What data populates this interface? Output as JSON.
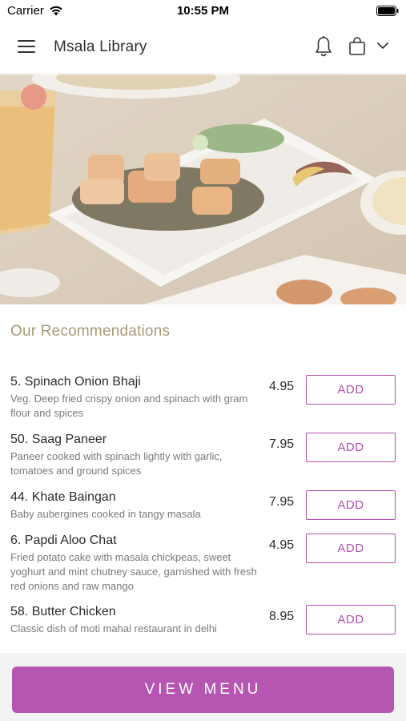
{
  "status_bar": {
    "carrier": "Carrier",
    "time": "10:55 PM"
  },
  "header": {
    "title": "Msala Library",
    "icons": [
      "menu-icon",
      "bell-icon",
      "shopping-bag-icon",
      "chevron-down-icon"
    ]
  },
  "hero": {
    "description_icon": "food-photo"
  },
  "recommendations": {
    "title": "Our Recommendations",
    "items": [
      {
        "name": "5. Spinach Onion Bhaji",
        "description": "Veg. Deep fried crispy onion and spinach with gram flour and spices",
        "price": "4.95",
        "button": "ADD"
      },
      {
        "name": "50. Saag Paneer",
        "description": "Paneer cooked with spinach lightly with garlic, tomatoes and ground spices",
        "price": "7.95",
        "button": "ADD"
      },
      {
        "name": "44. Khate Baingan",
        "description": "Baby aubergines cooked in tangy masala",
        "price": "7.95",
        "button": "ADD"
      },
      {
        "name": "6. Papdi Aloo Chat",
        "description": "Fried potato cake with masala chickpeas, sweet yoghurt and mint chutney sauce, garnished with fresh red onions and raw mango",
        "price": "4.95",
        "button": "ADD"
      },
      {
        "name": "58. Butter Chicken",
        "description": "Classic dish of moti mahal restaurant in delhi",
        "price": "8.95",
        "button": "ADD"
      }
    ]
  },
  "footer": {
    "view_menu_label": "VIEW MENU"
  },
  "colors": {
    "accent": "#b556b3",
    "section_title": "#a99a78"
  }
}
